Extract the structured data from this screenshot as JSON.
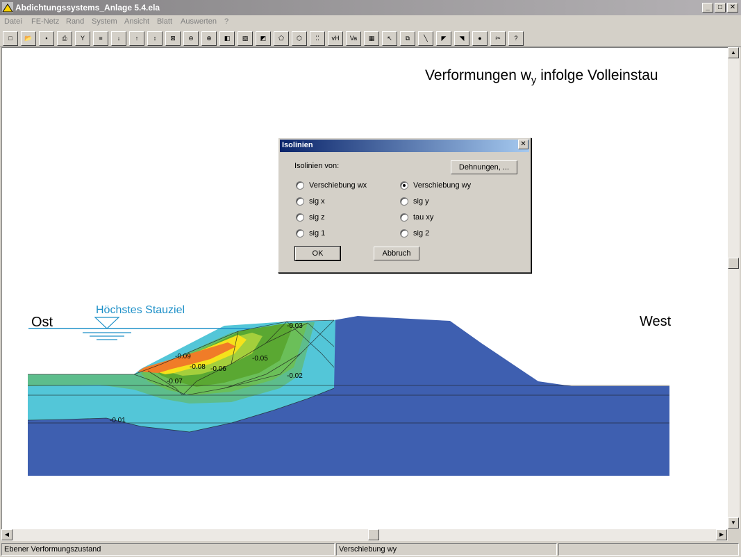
{
  "window": {
    "title": "Abdichtungssystems_Anlage 5.4.ela",
    "min": "_",
    "max": "□",
    "close": "✕"
  },
  "menu": [
    "Datei",
    "FE-Netz",
    "Rand",
    "System",
    "Ansicht",
    "Blatt",
    "Auswerten",
    "?"
  ],
  "toolbar": {
    "buttons": [
      {
        "name": "new-icon",
        "glyph": "□"
      },
      {
        "name": "open-icon",
        "glyph": "📂"
      },
      {
        "name": "save-icon",
        "glyph": "▪"
      },
      {
        "name": "print-icon",
        "glyph": "⎙"
      },
      {
        "name": "wrench-icon",
        "glyph": "Y"
      },
      {
        "name": "list-icon",
        "glyph": "≡"
      },
      {
        "name": "arrow-down-icon",
        "glyph": "↓"
      },
      {
        "name": "arrow-up-icon",
        "glyph": "↑"
      },
      {
        "name": "arrow-updown-icon",
        "glyph": "↕"
      },
      {
        "name": "crop-icon",
        "glyph": "⊠"
      },
      {
        "name": "zoom-out-icon",
        "glyph": "⊖"
      },
      {
        "name": "zoom-in-icon",
        "glyph": "⊕"
      },
      {
        "name": "shape-icon",
        "glyph": "◧"
      },
      {
        "name": "paint-icon",
        "glyph": "▨"
      },
      {
        "name": "fill-icon",
        "glyph": "◩"
      },
      {
        "name": "polygon-icon",
        "glyph": "⬠"
      },
      {
        "name": "outline-icon",
        "glyph": "⬡"
      },
      {
        "name": "grid-dots-icon",
        "glyph": "⁚⁚"
      },
      {
        "name": "vh-icon",
        "glyph": "vH"
      },
      {
        "name": "va-icon",
        "glyph": "Va"
      },
      {
        "name": "table-icon",
        "glyph": "▦"
      },
      {
        "name": "cursor-icon",
        "glyph": "↖"
      },
      {
        "name": "copy-icon",
        "glyph": "⧉"
      },
      {
        "name": "line-icon",
        "glyph": "╲"
      },
      {
        "name": "contour-icon",
        "glyph": "◤"
      },
      {
        "name": "contour-lines-icon",
        "glyph": "◥"
      },
      {
        "name": "record-icon",
        "glyph": "●"
      },
      {
        "name": "scissors-icon",
        "glyph": "✂"
      },
      {
        "name": "help-icon",
        "glyph": "?"
      }
    ]
  },
  "plot": {
    "title_main": "Verformungen w",
    "title_sub": "y",
    "title_rest": " infolge Volleinstau",
    "label_ost": "Ost",
    "label_west": "West",
    "label_water": "Höchstes Stauziel",
    "contour_labels": [
      "-0.03",
      "-0.09",
      "-0.08",
      "-0.06",
      "-0.05",
      "-0.07",
      "-0.02",
      "-0.01"
    ],
    "colors": {
      "blue": "#3e5fb0",
      "cyan": "#53c6d8",
      "green1": "#5dbd8c",
      "green2": "#6bbf59",
      "green3": "#5aa832",
      "lime": "#a4cf3c",
      "yellow": "#f5e21b",
      "orange": "#f07c28",
      "water": "#1e90c8"
    }
  },
  "dialog": {
    "title": "Isolinien",
    "close": "✕",
    "label": "Isolinien von:",
    "dehnungen": "Dehnungen, ...",
    "options_left": [
      {
        "label": "Verschiebung wx",
        "checked": false
      },
      {
        "label": "sig x",
        "checked": false
      },
      {
        "label": "sig z",
        "checked": false
      },
      {
        "label": "sig 1",
        "checked": false
      }
    ],
    "options_right": [
      {
        "label": "Verschiebung wy",
        "checked": true
      },
      {
        "label": "sig y",
        "checked": false
      },
      {
        "label": "tau xy",
        "checked": false
      },
      {
        "label": "sig 2",
        "checked": false
      }
    ],
    "ok": "OK",
    "cancel": "Abbruch"
  },
  "status": {
    "left": "Ebener Verformungszustand",
    "middle": "Verschiebung wy"
  }
}
